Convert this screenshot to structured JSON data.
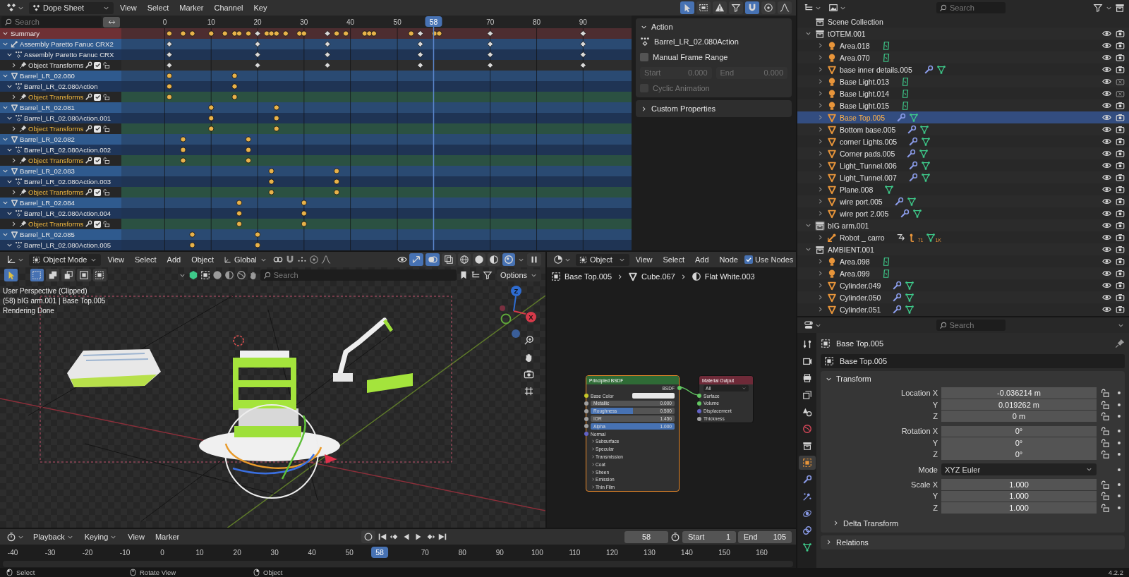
{
  "dope_sheet": {
    "header": {
      "editor": "Dope Sheet",
      "menus": [
        "View",
        "Select",
        "Marker",
        "Channel",
        "Key"
      ],
      "toggles": [
        {
          "kind": "cursor",
          "on": true
        },
        {
          "kind": "box-select",
          "on": false
        },
        {
          "kind": "warning",
          "on": false
        },
        {
          "kind": "filter",
          "on": false
        },
        {
          "kind": "magnet",
          "on": true
        },
        {
          "kind": "proportional",
          "on": false
        },
        {
          "kind": "falloff",
          "on": false
        }
      ]
    },
    "search": {
      "placeholder": "Search"
    },
    "channels": [
      {
        "label": "Summary",
        "kind": "summary",
        "expanded": true,
        "keys": [
          {
            "kind": "circle",
            "level": 0.094
          },
          {
            "kind": "circle",
            "level": 0.121
          },
          {
            "kind": "circle",
            "level": 0.139
          },
          {
            "kind": "circle",
            "level": 0.176
          },
          {
            "kind": "circle",
            "level": 0.203
          },
          {
            "kind": "circle",
            "level": 0.222
          },
          {
            "kind": "circle",
            "level": 0.231
          },
          {
            "kind": "circle",
            "level": 0.249
          },
          {
            "kind": "diamond",
            "level": 0.267
          },
          {
            "kind": "circle",
            "level": 0.285
          },
          {
            "kind": "circle",
            "level": 0.294
          },
          {
            "kind": "circle",
            "level": 0.304
          },
          {
            "kind": "circle",
            "level": 0.322
          },
          {
            "kind": "circle",
            "level": 0.349
          },
          {
            "kind": "circle",
            "level": 0.358
          },
          {
            "kind": "diamond",
            "level": 0.404
          },
          {
            "kind": "circle",
            "level": 0.422
          },
          {
            "kind": "circle",
            "level": 0.44
          },
          {
            "kind": "circle",
            "level": 0.477
          },
          {
            "kind": "circle",
            "level": 0.486
          },
          {
            "kind": "circle",
            "level": 0.495
          },
          {
            "kind": "circle",
            "level": 0.568
          },
          {
            "kind": "diamond",
            "level": 0.586
          },
          {
            "kind": "circle",
            "level": 0.614
          },
          {
            "kind": "circle",
            "level": 0.623
          },
          {
            "kind": "diamond",
            "level": 0.723
          },
          {
            "kind": "diamond",
            "level": 0.905
          }
        ]
      },
      {
        "label": "Assembly Paretto Fanuc CRX2",
        "kind": "armature",
        "expanded": true,
        "keys": [
          {
            "kind": "diamond",
            "level": 0.094
          },
          {
            "kind": "diamond",
            "level": 0.267
          },
          {
            "kind": "diamond",
            "level": 0.404
          },
          {
            "kind": "diamond",
            "level": 0.586
          },
          {
            "kind": "diamond",
            "level": 0.723
          },
          {
            "kind": "diamond",
            "level": 0.905
          }
        ]
      },
      {
        "label": "Assembly Paretto Fanuc CRX",
        "kind": "action",
        "expanded": true,
        "keys": [
          {
            "kind": "diamond",
            "level": 0.094
          },
          {
            "kind": "diamond",
            "level": 0.267
          },
          {
            "kind": "diamond",
            "level": 0.404
          },
          {
            "kind": "diamond",
            "level": 0.586
          },
          {
            "kind": "diamond",
            "level": 0.723
          },
          {
            "kind": "diamond",
            "level": 0.905
          }
        ]
      },
      {
        "label": "Object Transforms",
        "kind": "group",
        "expanded": false,
        "selected": false,
        "enabled": true,
        "keys": [
          {
            "kind": "diamond",
            "level": 0.094
          },
          {
            "kind": "diamond",
            "level": 0.267
          },
          {
            "kind": "diamond",
            "level": 0.404
          },
          {
            "kind": "diamond",
            "level": 0.586
          },
          {
            "kind": "diamond",
            "level": 0.723
          },
          {
            "kind": "diamond",
            "level": 0.905
          }
        ]
      },
      {
        "label": "Barrel_LR_02.080",
        "kind": "mesh",
        "expanded": true,
        "keys": [
          {
            "kind": "circle",
            "level": 0.094
          },
          {
            "kind": "circle",
            "level": 0.222
          }
        ]
      },
      {
        "label": "Barrel_LR_02.080Action",
        "kind": "action",
        "expanded": true,
        "keys": [
          {
            "kind": "circle",
            "level": 0.094
          },
          {
            "kind": "circle",
            "level": 0.222
          }
        ]
      },
      {
        "label": "Object Transforms",
        "kind": "group",
        "expanded": false,
        "selected": true,
        "enabled": true,
        "keys": [
          {
            "kind": "circle",
            "level": 0.094
          },
          {
            "kind": "circle",
            "level": 0.222
          }
        ]
      },
      {
        "label": "Barrel_LR_02.081",
        "kind": "mesh",
        "expanded": true,
        "keys": [
          {
            "kind": "circle",
            "level": 0.176
          },
          {
            "kind": "circle",
            "level": 0.304
          }
        ]
      },
      {
        "label": "Barrel_LR_02.080Action.001",
        "kind": "action",
        "expanded": true,
        "keys": [
          {
            "kind": "circle",
            "level": 0.176
          },
          {
            "kind": "circle",
            "level": 0.304
          }
        ]
      },
      {
        "label": "Object Transforms",
        "kind": "group",
        "expanded": false,
        "selected": true,
        "enabled": true,
        "keys": [
          {
            "kind": "circle",
            "level": 0.176
          },
          {
            "kind": "circle",
            "level": 0.304
          }
        ]
      },
      {
        "label": "Barrel_LR_02.082",
        "kind": "mesh",
        "expanded": true,
        "keys": [
          {
            "kind": "circle",
            "level": 0.121
          },
          {
            "kind": "circle",
            "level": 0.249
          }
        ]
      },
      {
        "label": "Barrel_LR_02.080Action.002",
        "kind": "action",
        "expanded": true,
        "keys": [
          {
            "kind": "circle",
            "level": 0.121
          },
          {
            "kind": "circle",
            "level": 0.249
          }
        ]
      },
      {
        "label": "Object Transforms",
        "kind": "group",
        "expanded": false,
        "selected": true,
        "enabled": true,
        "keys": [
          {
            "kind": "circle",
            "level": 0.121
          },
          {
            "kind": "circle",
            "level": 0.249
          }
        ]
      },
      {
        "label": "Barrel_LR_02.083",
        "kind": "mesh",
        "expanded": true,
        "keys": [
          {
            "kind": "circle",
            "level": 0.294
          },
          {
            "kind": "circle",
            "level": 0.422
          }
        ]
      },
      {
        "label": "Barrel_LR_02.080Action.003",
        "kind": "action",
        "expanded": true,
        "keys": [
          {
            "kind": "circle",
            "level": 0.294
          },
          {
            "kind": "circle",
            "level": 0.422
          }
        ]
      },
      {
        "label": "Object Transforms",
        "kind": "group",
        "expanded": false,
        "selected": true,
        "enabled": true,
        "keys": [
          {
            "kind": "circle",
            "level": 0.294
          },
          {
            "kind": "circle",
            "level": 0.422
          }
        ]
      },
      {
        "label": "Barrel_LR_02.084",
        "kind": "mesh",
        "expanded": true,
        "keys": [
          {
            "kind": "circle",
            "level": 0.231
          },
          {
            "kind": "circle",
            "level": 0.358
          }
        ]
      },
      {
        "label": "Barrel_LR_02.080Action.004",
        "kind": "action",
        "expanded": true,
        "keys": [
          {
            "kind": "circle",
            "level": 0.231
          },
          {
            "kind": "circle",
            "level": 0.358
          }
        ]
      },
      {
        "label": "Object Transforms",
        "kind": "group",
        "expanded": false,
        "selected": true,
        "enabled": true,
        "keys": [
          {
            "kind": "circle",
            "level": 0.231
          },
          {
            "kind": "circle",
            "level": 0.358
          }
        ]
      },
      {
        "label": "Barrel_LR_02.085",
        "kind": "mesh",
        "expanded": true,
        "keys": [
          {
            "kind": "circle",
            "level": 0.139
          },
          {
            "kind": "circle",
            "level": 0.267
          }
        ]
      },
      {
        "label": "Barrel_LR_02.080Action.005",
        "kind": "action",
        "expanded": true,
        "keys": [
          {
            "kind": "circle",
            "level": 0.139
          },
          {
            "kind": "circle",
            "level": 0.267
          }
        ]
      }
    ],
    "ruler": [
      {
        "label": "0",
        "level": 0.085
      },
      {
        "label": "10",
        "level": 0.176
      },
      {
        "label": "20",
        "level": 0.267
      },
      {
        "label": "30",
        "level": 0.358
      },
      {
        "label": "40",
        "level": 0.449
      },
      {
        "label": "50",
        "level": 0.541
      },
      {
        "label": "70",
        "level": 0.723
      },
      {
        "label": "80",
        "level": 0.814
      },
      {
        "label": "90",
        "level": 0.905
      }
    ],
    "playhead": {
      "label": "58",
      "level": 0.612
    },
    "sidebar": {
      "title": "Action",
      "expanded": true,
      "action_name": "Barrel_LR_02.080Action",
      "manual_frame_range": {
        "label": "Manual Frame Range",
        "checked": false
      },
      "start": {
        "label": "Start",
        "value": "0.000",
        "disabled": true
      },
      "end": {
        "label": "End",
        "value": "0.000",
        "disabled": true
      },
      "cyclic": {
        "label": "Cyclic Animation",
        "checked": false,
        "disabled": true
      },
      "custom_properties": {
        "title": "Custom Properties",
        "expanded": false
      }
    }
  },
  "viewport": {
    "header": {
      "mode": "Object Mode",
      "menus": [
        "View",
        "Select",
        "Add",
        "Object"
      ],
      "orientation": "Global",
      "toggles": [
        {
          "kind": "gizmo",
          "on": true
        },
        {
          "kind": "overlay",
          "on": true
        },
        {
          "kind": "xray",
          "on": false
        }
      ],
      "shading": [
        {
          "kind": "wireframe",
          "selected": false
        },
        {
          "kind": "solid",
          "selected": false
        },
        {
          "kind": "material",
          "selected": false
        },
        {
          "kind": "rendered",
          "selected": true
        }
      ]
    },
    "select_modes": [
      {
        "kind": "set",
        "selected": true
      },
      {
        "kind": "extend",
        "selected": false
      },
      {
        "kind": "subtract",
        "selected": false
      },
      {
        "kind": "invert",
        "selected": false
      },
      {
        "kind": "intersect",
        "selected": false
      }
    ],
    "search": {
      "placeholder": "Search"
    },
    "options": "Options",
    "overlay": [
      "User Perspective (Clipped)",
      "(58) bIG arm.001 | Base Top.005",
      "Rendering Done"
    ],
    "axes": [
      "Z",
      "X"
    ]
  },
  "node_editor": {
    "header": {
      "type": "Object",
      "menus": [
        "View",
        "Select",
        "Add",
        "Node"
      ],
      "use_nodes": {
        "label": "Use Nodes",
        "checked": true
      }
    },
    "breadcrumbs": [
      {
        "label": "Base Top.005",
        "kind": "object"
      },
      {
        "label": "Cube.067",
        "kind": "mesh"
      },
      {
        "label": "Flat White.003",
        "kind": "material"
      }
    ],
    "nodes": [
      {
        "title": "Principled BSDF",
        "kind": "shader",
        "selected": true,
        "rows": [
          {
            "kind": "output",
            "label": "BSDF"
          },
          {
            "kind": "color",
            "label": "Base Color"
          },
          {
            "kind": "value",
            "label": "Metallic",
            "value": "0.000",
            "level": 0
          },
          {
            "kind": "value",
            "label": "Roughness",
            "value": "0.500",
            "level": 0.5
          },
          {
            "kind": "value",
            "label": "IOR",
            "value": "1.450",
            "level": 0
          },
          {
            "kind": "value",
            "label": "Alpha",
            "value": "1.000",
            "level": 1
          },
          {
            "kind": "vector",
            "label": "Normal"
          },
          {
            "kind": "panel",
            "label": "Subsurface"
          },
          {
            "kind": "panel",
            "label": "Specular"
          },
          {
            "kind": "panel",
            "label": "Transmission"
          },
          {
            "kind": "panel",
            "label": "Coat"
          },
          {
            "kind": "panel",
            "label": "Sheen"
          },
          {
            "kind": "panel",
            "label": "Emission"
          },
          {
            "kind": "panel",
            "label": "Thin Film"
          }
        ]
      },
      {
        "title": "Material Output",
        "kind": "output",
        "selected": false,
        "rows": [
          {
            "kind": "dropdown",
            "label": "All"
          },
          {
            "kind": "shader",
            "label": "Surface"
          },
          {
            "kind": "shader",
            "label": "Volume"
          },
          {
            "kind": "vector",
            "label": "Displacement"
          },
          {
            "kind": "value",
            "label": "Thickness"
          }
        ]
      }
    ]
  },
  "timeline": {
    "menus": [
      {
        "label": "Playback",
        "dropdown": true
      },
      {
        "label": "Keying",
        "dropdown": true
      },
      {
        "label": "View",
        "dropdown": false
      },
      {
        "label": "Marker",
        "dropdown": false
      }
    ],
    "current_frame": "58",
    "start": {
      "label": "Start",
      "value": "1"
    },
    "end": {
      "label": "End",
      "value": "105"
    },
    "ruler": [
      {
        "label": "-40",
        "level": 0.016
      },
      {
        "label": "-30",
        "level": 0.063
      },
      {
        "label": "-20",
        "level": 0.11
      },
      {
        "label": "-10",
        "level": 0.157
      },
      {
        "label": "0",
        "level": 0.204
      },
      {
        "label": "10",
        "level": 0.251
      },
      {
        "label": "20",
        "level": 0.298
      },
      {
        "label": "30",
        "level": 0.345
      },
      {
        "label": "40",
        "level": 0.392
      },
      {
        "label": "50",
        "level": 0.439
      },
      {
        "label": "70",
        "level": 0.534
      },
      {
        "label": "80",
        "level": 0.581
      },
      {
        "label": "90",
        "level": 0.628
      },
      {
        "label": "100",
        "level": 0.675
      },
      {
        "label": "110",
        "level": 0.722
      },
      {
        "label": "120",
        "level": 0.769
      },
      {
        "label": "130",
        "level": 0.816
      },
      {
        "label": "140",
        "level": 0.863
      },
      {
        "label": "150",
        "level": 0.91
      },
      {
        "label": "160",
        "level": 0.957
      }
    ],
    "playhead": {
      "label": "58",
      "level": 0.477
    }
  },
  "outliner": {
    "search": {
      "placeholder": "Search"
    },
    "root": "Scene Collection",
    "items": [
      {
        "label": "tOTEM.001",
        "kind": "collection",
        "expanded": true,
        "active": false,
        "selected": false,
        "renderable": true,
        "children": [
          {
            "label": "Area.018",
            "kind": "light",
            "expanded": false,
            "selected": false,
            "renderable": true,
            "extras": [
              {
                "kind": "light_data"
              }
            ]
          },
          {
            "label": "Area.070",
            "kind": "light",
            "expanded": false,
            "selected": false,
            "renderable": true,
            "extras": [
              {
                "kind": "light_data"
              }
            ]
          },
          {
            "label": "base inner details.005",
            "kind": "mesh",
            "expanded": false,
            "selected": false,
            "renderable": true,
            "extras": [
              {
                "kind": "modifier"
              },
              {
                "kind": "mesh_data"
              }
            ]
          },
          {
            "label": "Base Light.013",
            "kind": "light",
            "expanded": false,
            "selected": false,
            "renderable": false,
            "extras": [
              {
                "kind": "light_data"
              }
            ]
          },
          {
            "label": "Base Light.014",
            "kind": "light",
            "expanded": false,
            "selected": false,
            "renderable": false,
            "extras": [
              {
                "kind": "light_data"
              }
            ]
          },
          {
            "label": "Base Light.015",
            "kind": "light",
            "expanded": false,
            "selected": false,
            "renderable": true,
            "extras": [
              {
                "kind": "light_data"
              }
            ]
          },
          {
            "label": "Base Top.005",
            "kind": "mesh",
            "expanded": false,
            "selected": true,
            "renderable": true,
            "extras": [
              {
                "kind": "modifier"
              },
              {
                "kind": "mesh_data"
              }
            ]
          },
          {
            "label": "Bottom base.005",
            "kind": "mesh",
            "expanded": false,
            "selected": false,
            "renderable": true,
            "extras": [
              {
                "kind": "modifier"
              },
              {
                "kind": "mesh_data"
              }
            ]
          },
          {
            "label": "corner Lights.005",
            "kind": "mesh",
            "expanded": false,
            "selected": false,
            "renderable": true,
            "extras": [
              {
                "kind": "modifier"
              },
              {
                "kind": "mesh_data"
              }
            ]
          },
          {
            "label": "Corner pads.005",
            "kind": "mesh",
            "expanded": false,
            "selected": false,
            "renderable": true,
            "extras": [
              {
                "kind": "modifier"
              },
              {
                "kind": "mesh_data"
              }
            ]
          },
          {
            "label": "Light_Tunnel.006",
            "kind": "mesh",
            "expanded": false,
            "selected": false,
            "renderable": true,
            "extras": [
              {
                "kind": "modifier"
              },
              {
                "kind": "mesh_data"
              }
            ]
          },
          {
            "label": "Light_Tunnel.007",
            "kind": "mesh",
            "expanded": false,
            "selected": false,
            "renderable": true,
            "extras": [
              {
                "kind": "modifier"
              },
              {
                "kind": "mesh_data"
              }
            ]
          },
          {
            "label": "Plane.008",
            "kind": "mesh",
            "expanded": false,
            "selected": false,
            "renderable": true,
            "extras": [
              {
                "kind": "mesh_data"
              }
            ]
          },
          {
            "label": "wire port.005",
            "kind": "mesh",
            "expanded": false,
            "selected": false,
            "renderable": true,
            "extras": [
              {
                "kind": "modifier"
              },
              {
                "kind": "mesh_data"
              }
            ]
          },
          {
            "label": "wire port 2.005",
            "kind": "mesh",
            "expanded": false,
            "selected": false,
            "renderable": true,
            "extras": [
              {
                "kind": "modifier"
              },
              {
                "kind": "mesh_data"
              }
            ]
          }
        ]
      },
      {
        "label": "bIG arm.001",
        "kind": "collection",
        "expanded": true,
        "active": true,
        "selected": false,
        "renderable": true,
        "children": [
          {
            "label": "Robot _ carro",
            "kind": "armature",
            "expanded": false,
            "selected": false,
            "renderable": true,
            "extras": [
              {
                "kind": "link"
              },
              {
                "kind": "armature_data",
                "count": "71"
              },
              {
                "kind": "mesh_data",
                "count": "1K"
              }
            ]
          }
        ]
      },
      {
        "label": "AMBIENT.001",
        "kind": "collection",
        "expanded": true,
        "active": false,
        "selected": false,
        "renderable": true,
        "children": [
          {
            "label": "Area.098",
            "kind": "light",
            "expanded": false,
            "selected": false,
            "renderable": true,
            "extras": [
              {
                "kind": "light_data"
              }
            ]
          },
          {
            "label": "Area.099",
            "kind": "light",
            "expanded": false,
            "selected": false,
            "renderable": true,
            "extras": [
              {
                "kind": "light_data"
              }
            ]
          },
          {
            "label": "Cylinder.049",
            "kind": "mesh",
            "expanded": false,
            "selected": false,
            "renderable": true,
            "extras": [
              {
                "kind": "modifier"
              },
              {
                "kind": "mesh_data"
              }
            ]
          },
          {
            "label": "Cylinder.050",
            "kind": "mesh",
            "expanded": false,
            "selected": false,
            "renderable": true,
            "extras": [
              {
                "kind": "modifier"
              },
              {
                "kind": "mesh_data"
              }
            ]
          },
          {
            "label": "Cylinder.051",
            "kind": "mesh",
            "expanded": false,
            "selected": false,
            "renderable": true,
            "extras": [
              {
                "kind": "modifier"
              },
              {
                "kind": "mesh_data"
              }
            ]
          }
        ]
      }
    ]
  },
  "properties": {
    "search": {
      "placeholder": "Search"
    },
    "tabs": [
      {
        "kind": "tool",
        "selected": false
      },
      {
        "kind": "render",
        "selected": false
      },
      {
        "kind": "output",
        "selected": false
      },
      {
        "kind": "view_layer",
        "selected": false
      },
      {
        "kind": "scene",
        "selected": false
      },
      {
        "kind": "world",
        "selected": false
      },
      {
        "kind": "collection",
        "selected": false
      },
      {
        "kind": "object",
        "selected": true
      },
      {
        "kind": "modifier",
        "selected": false
      },
      {
        "kind": "particles",
        "selected": false
      },
      {
        "kind": "physics",
        "selected": false
      },
      {
        "kind": "constraint",
        "selected": false
      },
      {
        "kind": "data",
        "selected": false
      }
    ],
    "title": "Base Top.005",
    "object_name": "Base Top.005",
    "transform": {
      "title": "Transform",
      "expanded": true,
      "groups": [
        {
          "rows": [
            {
              "kind": "number",
              "label": "Location X",
              "value": "-0.036214 m"
            },
            {
              "kind": "number",
              "label": "Y",
              "value": "0.019262 m"
            },
            {
              "kind": "number",
              "label": "Z",
              "value": "0 m"
            }
          ]
        },
        {
          "rows": [
            {
              "kind": "number",
              "label": "Rotation X",
              "value": "0°"
            },
            {
              "kind": "number",
              "label": "Y",
              "value": "0°"
            },
            {
              "kind": "number",
              "label": "Z",
              "value": "0°"
            }
          ]
        },
        {
          "rows": [
            {
              "kind": "dropdown",
              "label": "Mode",
              "value": "XYZ Euler"
            }
          ]
        },
        {
          "rows": [
            {
              "kind": "number",
              "label": "Scale X",
              "value": "1.000"
            },
            {
              "kind": "number",
              "label": "Y",
              "value": "1.000"
            },
            {
              "kind": "number",
              "label": "Z",
              "value": "1.000"
            }
          ]
        }
      ],
      "delta": {
        "title": "Delta Transform",
        "expanded": false
      }
    },
    "panels": [
      {
        "title": "Relations",
        "expanded": false
      }
    ]
  },
  "status_bar": {
    "items": [
      {
        "label": "Select",
        "kind": "mouse-left"
      },
      {
        "label": "Rotate View",
        "kind": "mouse-mid"
      },
      {
        "label": "Object",
        "kind": "mouse-right"
      }
    ],
    "version": "4.2.2"
  }
}
